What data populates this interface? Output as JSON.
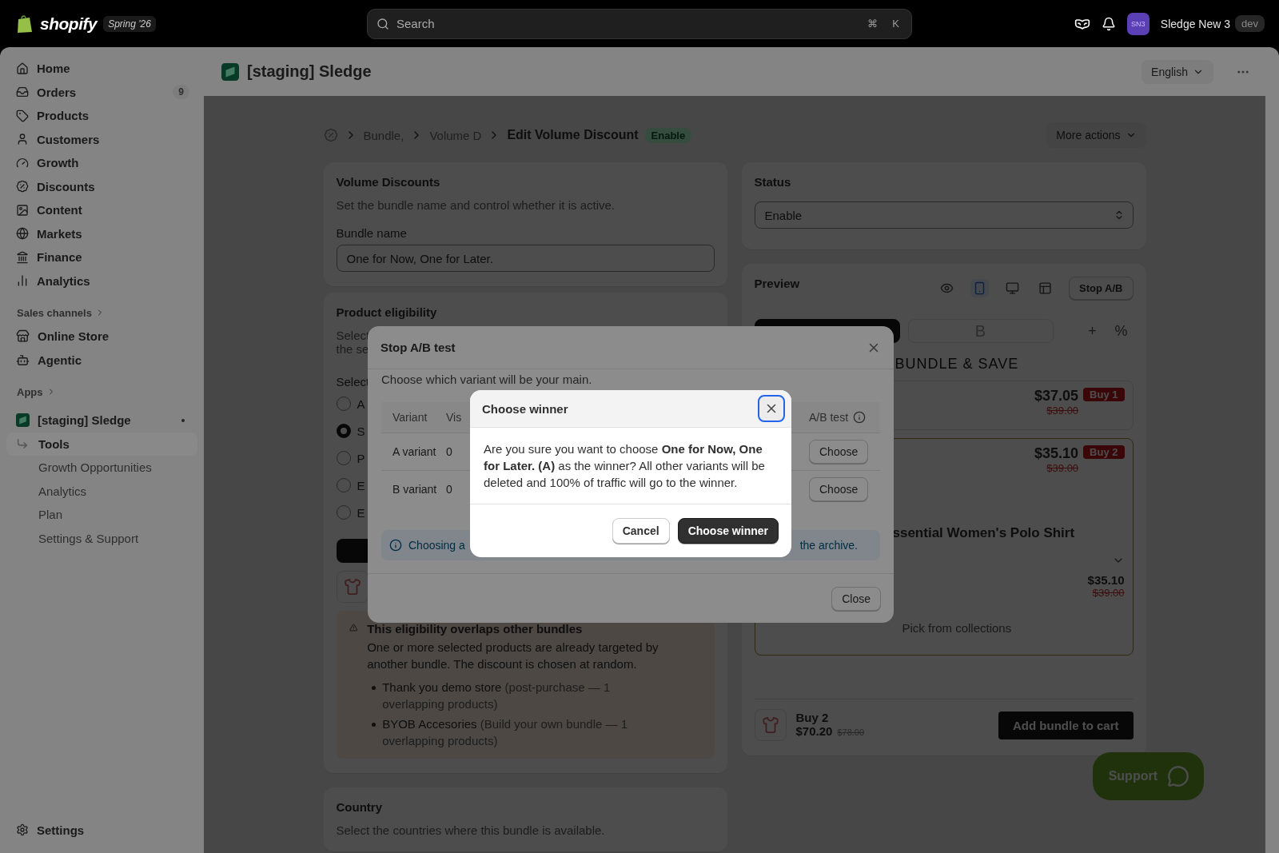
{
  "topbar": {
    "brand": "shopify",
    "edition": "Spring '26",
    "search": {
      "placeholder": "Search",
      "shortcut": [
        "⌘",
        "K"
      ]
    },
    "store": {
      "initials": "SN3",
      "name": "Sledge New 3",
      "badge": "dev"
    }
  },
  "sidebar": {
    "items": [
      {
        "label": "Home"
      },
      {
        "label": "Orders",
        "badge": "9"
      },
      {
        "label": "Products"
      },
      {
        "label": "Customers"
      },
      {
        "label": "Growth"
      },
      {
        "label": "Discounts"
      },
      {
        "label": "Content"
      },
      {
        "label": "Markets"
      },
      {
        "label": "Finance"
      },
      {
        "label": "Analytics"
      }
    ],
    "sales_channels": {
      "title": "Sales channels",
      "items": [
        {
          "label": "Online Store"
        },
        {
          "label": "Agentic"
        }
      ]
    },
    "apps": {
      "title": "Apps",
      "app": {
        "label": "[staging] Sledge",
        "pinned": true,
        "items": [
          {
            "label": "Tools",
            "selected": true
          },
          {
            "label": "Growth Opportunities",
            "selected": false
          },
          {
            "label": "Analytics",
            "selected": false
          },
          {
            "label": "Plan",
            "selected": false
          },
          {
            "label": "Settings & Support",
            "selected": false
          }
        ]
      }
    },
    "settings": "Settings"
  },
  "header": {
    "app_title": "[staging] Sledge",
    "language": "English"
  },
  "breadcrumb": {
    "items": [
      "Bundle,",
      "Volume D"
    ],
    "current": "Edit Volume Discount",
    "badge": "Enable",
    "more_actions": "More actions"
  },
  "volume_card": {
    "title": "Volume Discounts",
    "description": "Set the bundle name and control whether it is active.",
    "field_label": "Bundle name",
    "value": "One for Now, One for Later."
  },
  "eligibility_card": {
    "title": "Product eligibility",
    "description_lines": [
      "Select",
      "the se"
    ],
    "select_label": "Select",
    "radios": [
      {
        "label": "A",
        "selected": false
      },
      {
        "label": "S",
        "selected": true
      },
      {
        "label": "P",
        "selected": false
      },
      {
        "label": "E",
        "selected": false
      },
      {
        "label": "E",
        "selected": false
      }
    ],
    "warning": {
      "title": "This eligibility overlaps other bundles",
      "body": "One or more selected products are already targeted by another bundle. The discount is chosen at random.",
      "items": [
        {
          "name": "Thank you demo store",
          "detail": "(post-purchase — 1 overlapping products)"
        },
        {
          "name": "BYOB Accesories",
          "detail": "(Build your own bundle — 1 overlapping products)"
        }
      ]
    }
  },
  "country_card": {
    "title": "Country",
    "description": "Select the countries where this bundle is available."
  },
  "status_card": {
    "title": "Status",
    "value": "Enable"
  },
  "preview_card": {
    "title": "Preview",
    "devices": [
      {
        "selected": false
      },
      {
        "selected": true
      },
      {
        "selected": false
      },
      {
        "selected": false
      }
    ],
    "stop_button": "Stop A/B",
    "variant_tabs": [
      {
        "selected": true
      },
      {
        "label": "B",
        "selected": false
      }
    ],
    "tab_actions": [
      "+",
      "%"
    ],
    "heading": "BUNDLE & SAVE",
    "tiers": [
      {
        "price": "$37.05",
        "compare": "$39.00",
        "badge": "Buy 1",
        "selected": false
      },
      {
        "price": "$35.10",
        "compare": "$39.00",
        "badge": "Buy 2",
        "selected": true,
        "product": "ssential Women's Polo Shirt",
        "item_price": "$35.10",
        "item_compare": "$39.00",
        "picker": "Pick from collections"
      }
    ],
    "footer": {
      "title": "Buy 2",
      "price": "$70.20",
      "compare": "$78.00",
      "button": "Add bundle to cart"
    }
  },
  "support_button": "Support",
  "stop_modal": {
    "title": "Stop A/B test",
    "intro": "Choose which variant will be your main.",
    "columns": [
      "Variant",
      "Vis",
      "A/B test"
    ],
    "rows": [
      {
        "name": "A variant",
        "visitors": "0",
        "action": "Choose"
      },
      {
        "name": "B variant",
        "visitors": "0",
        "action": "Choose"
      }
    ],
    "banner": {
      "start": "Choosing a",
      "end": "the archive."
    },
    "close": "Close"
  },
  "confirm_modal": {
    "title": "Choose winner",
    "body": "Are you sure you want to choose **One for Now, One for Later. (A)** as the winner? All other variants will be deleted and 100% of traffic will go to the winner.",
    "cancel": "Cancel",
    "confirm": "Choose winner"
  }
}
